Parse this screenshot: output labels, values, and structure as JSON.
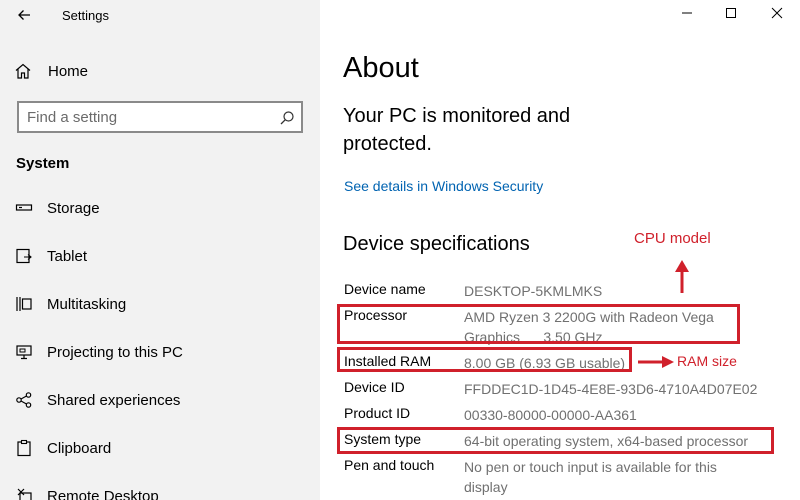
{
  "window": {
    "title": "Settings",
    "controls": [
      "minimize",
      "maximize",
      "close"
    ]
  },
  "sidebar": {
    "home_label": "Home",
    "search_placeholder": "Find a setting",
    "section_title": "System",
    "items": [
      {
        "label": "Storage",
        "icon": "storage-icon"
      },
      {
        "label": "Tablet",
        "icon": "tablet-icon"
      },
      {
        "label": "Multitasking",
        "icon": "multitasking-icon"
      },
      {
        "label": "Projecting to this PC",
        "icon": "projecting-icon"
      },
      {
        "label": "Shared experiences",
        "icon": "shared-experiences-icon"
      },
      {
        "label": "Clipboard",
        "icon": "clipboard-icon"
      },
      {
        "label": "Remote Desktop",
        "icon": "remote-desktop-icon"
      }
    ]
  },
  "main": {
    "title": "About",
    "status": "Your PC is monitored and protected.",
    "security_link": "See details in Windows Security",
    "specs_heading": "Device specifications",
    "specs": [
      {
        "key": "Device name",
        "value": "DESKTOP-5KMLMKS"
      },
      {
        "key": "Processor",
        "value": "AMD Ryzen 3 2200G with Radeon Vega Graphics      3.50 GHz"
      },
      {
        "key": "Installed RAM",
        "value": "8.00 GB (6.93 GB usable)"
      },
      {
        "key": "Device ID",
        "value": "FFDDEC1D-1D45-4E8E-93D6-4710A4D07E02"
      },
      {
        "key": "Product ID",
        "value": "00330-80000-00000-AA361"
      },
      {
        "key": "System type",
        "value": "64-bit operating system, x64-based processor"
      },
      {
        "key": "Pen and touch",
        "value": "No pen or touch input is available for this display"
      }
    ]
  },
  "annotations": {
    "cpu_label": "CPU model",
    "ram_label": "RAM size",
    "color": "#d0202b"
  },
  "colors": {
    "sidebar_bg": "#f2f2f2",
    "link": "#0063b1",
    "value_text": "#707070"
  }
}
